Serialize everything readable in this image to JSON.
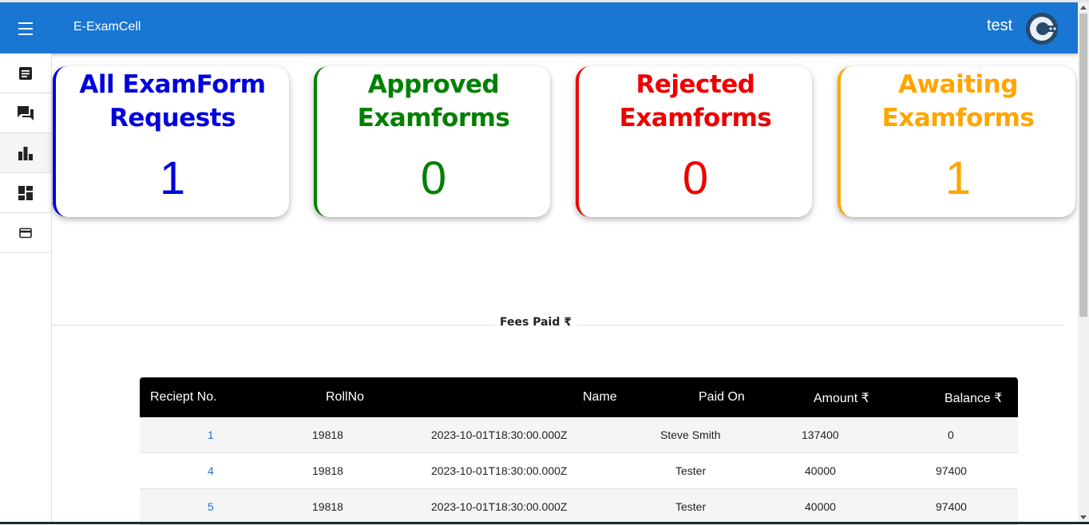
{
  "header": {
    "app_title": "E-ExamCell",
    "user_name": "test",
    "menu_icon": "hamburger-icon",
    "avatar_icon": "user-avatar"
  },
  "sidebar": {
    "items": [
      {
        "icon": "form-icon"
      },
      {
        "icon": "chat-icon"
      },
      {
        "icon": "bar-chart-icon"
      },
      {
        "icon": "dashboard-icon"
      },
      {
        "icon": "card-icon"
      }
    ]
  },
  "cards": [
    {
      "title_line1": "All ExamForm",
      "title_line2": "Requests",
      "count": "1",
      "color": "#0000dd"
    },
    {
      "title_line1": "Approved",
      "title_line2": "Examforms",
      "count": "0",
      "color": "#008000"
    },
    {
      "title_line1": "Rejected",
      "title_line2": "Examforms",
      "count": "0",
      "color": "#ee0000"
    },
    {
      "title_line1": "Awaiting",
      "title_line2": "Examforms",
      "count": "1",
      "color": "#ffa500"
    }
  ],
  "fees_section": {
    "label": "Fees Paid ₹"
  },
  "table": {
    "headers": [
      "Reciept No.",
      "RollNo",
      "Name",
      "Paid On",
      "Amount ₹",
      "Balance ₹"
    ],
    "rows": [
      [
        "1",
        "19818",
        "2023-10-01T18:30:00.000Z",
        "Steve Smith",
        "137400",
        "0"
      ],
      [
        "4",
        "19818",
        "2023-10-01T18:30:00.000Z",
        "Tester",
        "40000",
        "97400"
      ],
      [
        "5",
        "19818",
        "2023-10-01T18:30:00.000Z",
        "Tester",
        "40000",
        "97400"
      ]
    ]
  }
}
